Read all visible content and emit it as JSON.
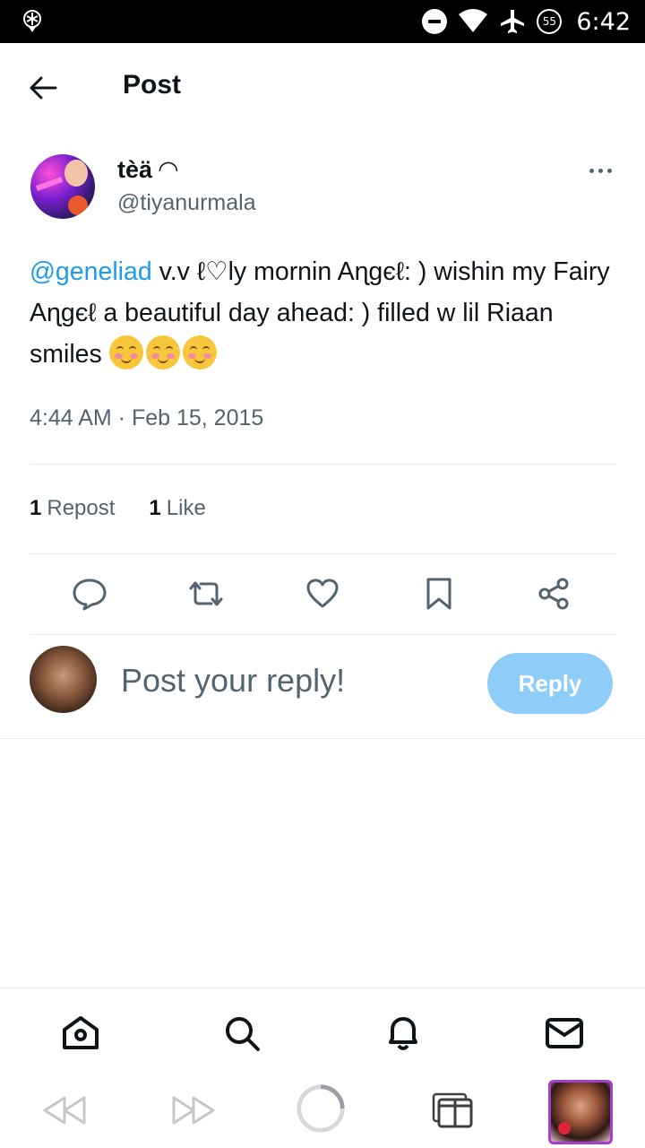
{
  "status_bar": {
    "time": "6:42",
    "badge": "55"
  },
  "header": {
    "title": "Post"
  },
  "post": {
    "author_name": "tèä ◠",
    "author_handle": "@tiyanurmala",
    "mention": "@geneliad",
    "text": " v.v ℓ♡ly mornin Aɳgєℓ: ) wishin my Fairy Aɳgєℓ a beautiful day ahead: ) filled w lil Riaan smiles ",
    "emoji_count": 3,
    "timestamp": "4:44 AM · Feb 15, 2015"
  },
  "stats": {
    "reposts_count": "1",
    "reposts_label": "Repost",
    "likes_count": "1",
    "likes_label": "Like"
  },
  "reply": {
    "placeholder": "Post your reply!",
    "button_label": "Reply"
  },
  "tabs": [
    "home-icon",
    "search-icon",
    "notifications-icon",
    "messages-icon"
  ],
  "colors": {
    "accent": "#1d9bf0",
    "reply_button": "#8ecdf7",
    "secondary_text": "#536471"
  }
}
